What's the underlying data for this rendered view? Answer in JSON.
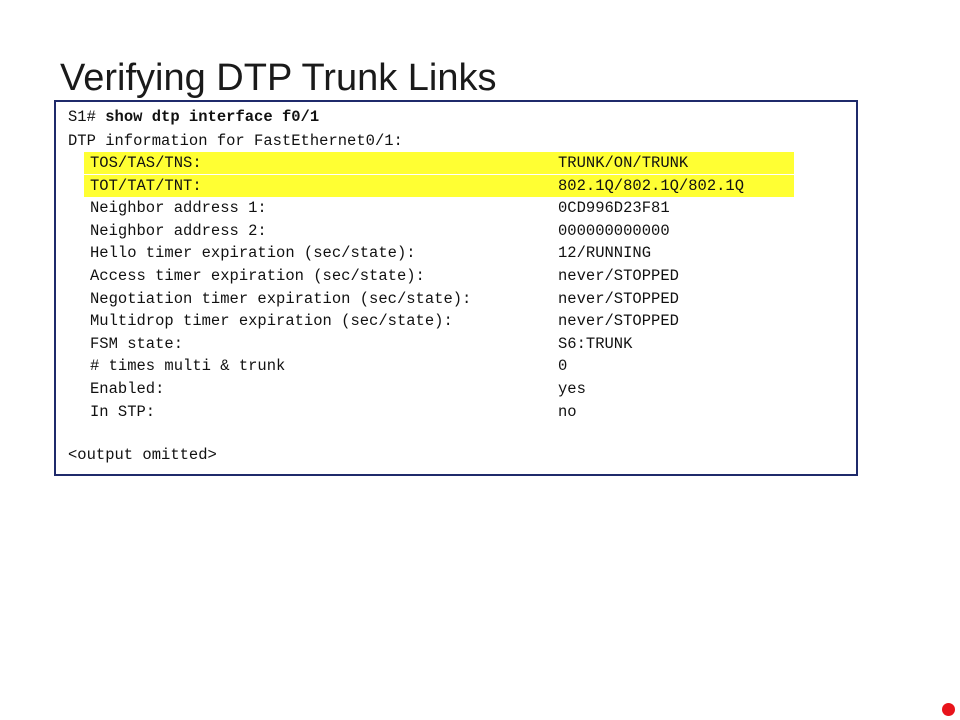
{
  "slide": {
    "title": "Verifying DTP Trunk Links"
  },
  "terminal": {
    "prompt": "S1# ",
    "command": "show dtp interface f0/1",
    "header": "DTP information for FastEthernet0/1:",
    "rows": [
      {
        "field": "TOS/TAS/TNS:",
        "value": "TRUNK/ON/TRUNK",
        "highlight": true
      },
      {
        "field": "TOT/TAT/TNT:",
        "value": "802.1Q/802.1Q/802.1Q",
        "highlight": true
      },
      {
        "field": "Neighbor address 1:",
        "value": "0CD996D23F81",
        "highlight": false
      },
      {
        "field": "Neighbor address 2:",
        "value": "000000000000",
        "highlight": false
      },
      {
        "field": "Hello timer expiration (sec/state):",
        "value": "12/RUNNING",
        "highlight": false
      },
      {
        "field": "Access timer expiration (sec/state):",
        "value": "never/STOPPED",
        "highlight": false
      },
      {
        "field": "Negotiation timer expiration (sec/state):",
        "value": "never/STOPPED",
        "highlight": false
      },
      {
        "field": "Multidrop timer expiration (sec/state):",
        "value": "never/STOPPED",
        "highlight": false
      },
      {
        "field": "FSM state:",
        "value": "S6:TRUNK",
        "highlight": false
      },
      {
        "field": "# times multi & trunk",
        "value": "0",
        "highlight": false
      },
      {
        "field": "Enabled:",
        "value": "yes",
        "highlight": false
      },
      {
        "field": "In STP:",
        "value": "no",
        "highlight": false
      }
    ],
    "footer": "<output omitted>"
  },
  "colors": {
    "highlight": "#ffff33",
    "border": "#1f2a6b",
    "marker": "#e8141b"
  }
}
